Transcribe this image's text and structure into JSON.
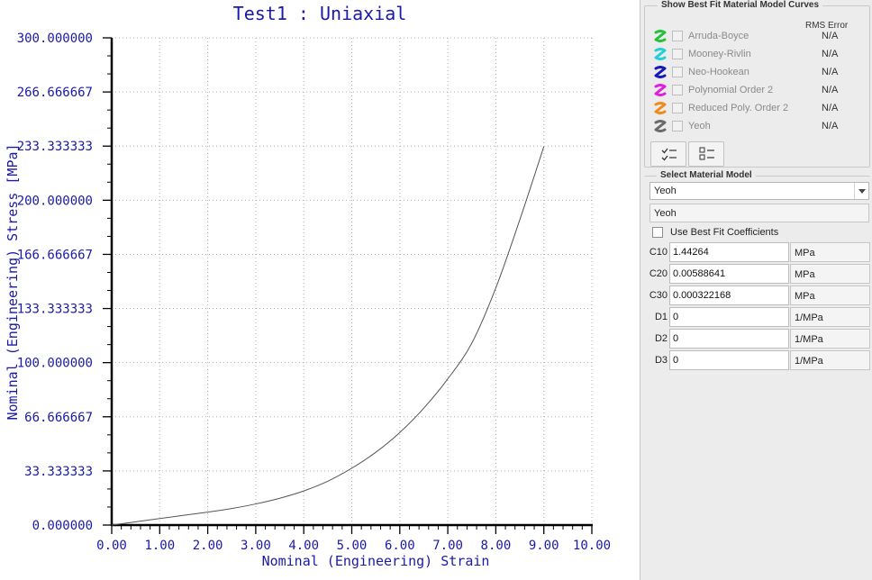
{
  "chart_data": {
    "type": "line",
    "title": "Test1 : Uniaxial",
    "xlabel": "Nominal (Engineering) Strain",
    "ylabel": "Nominal (Engineering) Stress [MPa]",
    "xlim": [
      0,
      10
    ],
    "ylim": [
      0,
      300
    ],
    "xticks": [
      "0.00",
      "1.00",
      "2.00",
      "3.00",
      "4.00",
      "5.00",
      "6.00",
      "7.00",
      "8.00",
      "9.00",
      "10.00"
    ],
    "yticks": [
      "0.000000",
      "33.333333",
      "66.666667",
      "100.000000",
      "133.333333",
      "166.666667",
      "200.000000",
      "233.333333",
      "266.666667",
      "300.000000"
    ],
    "grid": true,
    "series": [
      {
        "x": [
          0,
          0.5,
          1,
          1.5,
          2,
          2.5,
          3,
          3.5,
          4,
          4.5,
          5,
          5.5,
          6,
          6.5,
          7,
          7.5,
          8,
          8.5,
          9
        ],
        "y": [
          0,
          2,
          4,
          6,
          8,
          10.2,
          13,
          16.5,
          21,
          27,
          35,
          44.8,
          57,
          72,
          90,
          112,
          146,
          188,
          233
        ]
      }
    ],
    "colors": {
      "axis_text": "#1a1aa6",
      "axes": "#000000",
      "grid": "#b0b0b0",
      "line": "#555555"
    }
  },
  "best_fit": {
    "title": "Show Best Fit Material Model Curves",
    "rms_header": "RMS Error",
    "models": [
      {
        "label": "Arruda-Boyce",
        "rms": "N/A",
        "color": "#22c23a",
        "icon": "curve-icon"
      },
      {
        "label": "Mooney-Rivlin",
        "rms": "N/A",
        "color": "#21d0d8",
        "icon": "curve-icon"
      },
      {
        "label": "Neo-Hookean",
        "rms": "N/A",
        "color": "#1818b8",
        "icon": "curve-icon"
      },
      {
        "label": "Polynomial Order 2",
        "rms": "N/A",
        "color": "#e020d8",
        "icon": "curve-icon"
      },
      {
        "label": "Reduced Poly. Order 2",
        "rms": "N/A",
        "color": "#f08a18",
        "icon": "curve-icon"
      },
      {
        "label": "Yeoh",
        "rms": "N/A",
        "color": "#6a6a6a",
        "icon": "curve-icon"
      }
    ],
    "tools": [
      "select-all-icon",
      "deselect-all-icon"
    ]
  },
  "material": {
    "title": "Select Material Model",
    "selected": "Yeoh",
    "name": "Yeoh",
    "use_best_fit_label": "Use Best Fit Coefficients",
    "use_best_fit_checked": false,
    "coefficients": [
      {
        "label": "C10",
        "value": "1.44264",
        "unit": "MPa"
      },
      {
        "label": "C20",
        "value": "0.00588641",
        "unit": "MPa"
      },
      {
        "label": "C30",
        "value": "0.000322168",
        "unit": "MPa"
      },
      {
        "label": "D1",
        "value": "0",
        "unit": "1/MPa"
      },
      {
        "label": "D2",
        "value": "0",
        "unit": "1/MPa"
      },
      {
        "label": "D3",
        "value": "0",
        "unit": "1/MPa"
      }
    ]
  }
}
